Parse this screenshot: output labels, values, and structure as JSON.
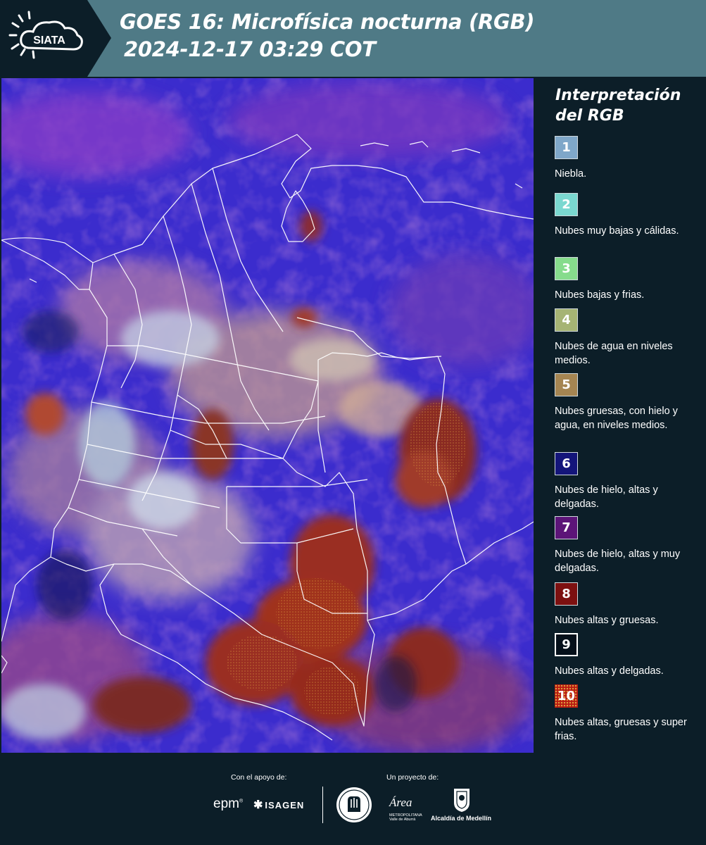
{
  "header": {
    "logo_text": "SIATA",
    "title_line1": "GOES 16: Microfísica nocturna (RGB)",
    "title_line2": "2024-12-17 03:29 COT",
    "colors": {
      "header_bg": "#4f7a86",
      "logo_bg": "#0c1e28"
    }
  },
  "legend": {
    "title": "Interpretación del RGB",
    "items": [
      {
        "number": "1",
        "label": "Niebla.",
        "color": "#7fa7c9"
      },
      {
        "number": "2",
        "label": "Nubes muy bajas y cálidas.",
        "color": "#7ad8d0"
      },
      {
        "number": "3",
        "label": "Nubes bajas y frias.",
        "color": "#86dc8c"
      },
      {
        "number": "4",
        "label": "Nubes de agua en niveles medios.",
        "color": "#a6b474"
      },
      {
        "number": "5",
        "label": "Nubes gruesas, con hielo y agua, en niveles medios.",
        "color": "#a58552"
      },
      {
        "number": "6",
        "label": "Nubes de hielo, altas y delgadas.",
        "color": "#14157a"
      },
      {
        "number": "7",
        "label": "Nubes de hielo, altas y muy delgadas.",
        "color": "#5c1478"
      },
      {
        "number": "8",
        "label": "Nubes altas y gruesas.",
        "color": "#7d1010"
      },
      {
        "number": "9",
        "label": "Nubes altas y delgadas.",
        "color": "#05101a"
      },
      {
        "number": "10",
        "label": "Nubes altas, gruesas y super frias.",
        "color": "#b81a12"
      }
    ]
  },
  "footer": {
    "support_label": "Con el apoyo de:",
    "project_label": "Un proyecto de:",
    "sponsor_epm": "epm",
    "sponsor_isagen": "ISAGEN",
    "area_name": "Área",
    "area_sub1": "METROPOLITANA",
    "area_sub2": "Valle de Aburrá",
    "medellin": "Alcaldía de Medellín"
  }
}
